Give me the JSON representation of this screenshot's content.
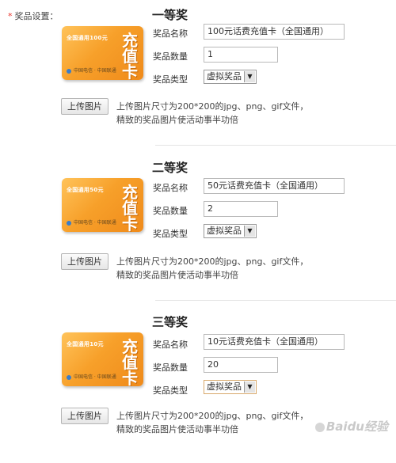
{
  "section": {
    "required_mark": "*",
    "label": "奖品设置："
  },
  "common": {
    "name_label": "奖品名称",
    "qty_label": "数量",
    "qty_label_full": "奖品数量",
    "type_label": "奖品类型",
    "upload_label": "上传图片",
    "hint_line1": "上传图片尺寸为200*200的jpg、png、gif文件，",
    "hint_line2": "精致的奖品图片使活动事半功倍",
    "card_stripe": "全国通用100元",
    "card_big_1": "充",
    "card_big_2": "值",
    "card_big_3": "卡",
    "card_logos": "中国电信 · 中国联通",
    "dropdown_arrow": "▼"
  },
  "prizes": [
    {
      "title": "一等奖",
      "name": "100元话费充值卡（全国通用）",
      "quantity": "1",
      "type": "虚拟奖品",
      "card_stripe": "全国通用100元"
    },
    {
      "title": "二等奖",
      "name": "50元话费充值卡（全国通用）",
      "quantity": "2",
      "type": "虚拟奖品",
      "card_stripe": "全国通用50元"
    },
    {
      "title": "三等奖",
      "name": "10元话费充值卡（全国通用）",
      "quantity": "20",
      "type": "虚拟奖品",
      "card_stripe": "全国通用10元"
    }
  ],
  "watermark": "Baidu经验",
  "colors": {
    "required": "#e8332b",
    "card_orange": "#f7a02a"
  }
}
